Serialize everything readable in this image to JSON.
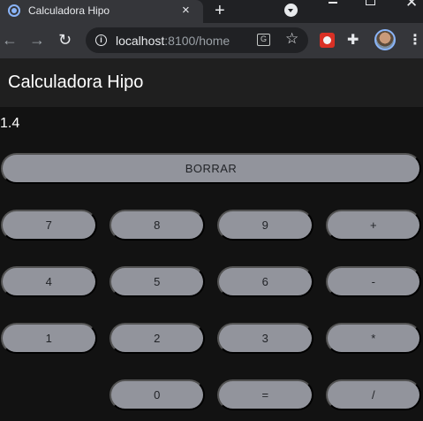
{
  "browser": {
    "tab_title": "Calculadora Hipo",
    "tab_close": "×",
    "new_tab": "+",
    "url_host": "localhost",
    "url_rest": ":8100/home",
    "icons": {
      "back": "arrow-left",
      "forward": "arrow-right",
      "reload": "reload",
      "info": "info",
      "translate": "translate",
      "star": "star",
      "extension": "extension",
      "puzzle": "puzzle",
      "menu": "kebab-menu"
    }
  },
  "app": {
    "title": "Calculadora Hipo",
    "display_value": "1.4",
    "clear_label": "BORRAR",
    "buttons": {
      "seven": "7",
      "eight": "8",
      "nine": "9",
      "plus": "+",
      "four": "4",
      "five": "5",
      "six": "6",
      "minus": "-",
      "one": "1",
      "two": "2",
      "three": "3",
      "multiply": "*",
      "zero": "0",
      "equals": "=",
      "divide": "/"
    }
  },
  "colors": {
    "background": "#121212",
    "header": "#1f1f1f",
    "button": "#92949c",
    "button_text": "#222428"
  }
}
